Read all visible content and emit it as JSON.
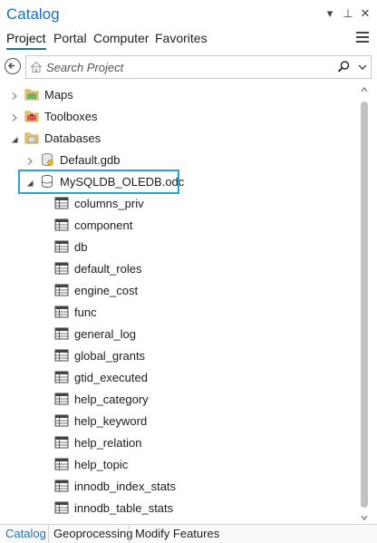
{
  "panel": {
    "title": "Catalog"
  },
  "title_buttons": {
    "options": "▾",
    "pin": "⊥",
    "close": "✕"
  },
  "tabs": [
    {
      "label": "Project",
      "active": true
    },
    {
      "label": "Portal",
      "active": false
    },
    {
      "label": "Computer",
      "active": false
    },
    {
      "label": "Favorites",
      "active": false
    }
  ],
  "search": {
    "placeholder": "Search Project",
    "value": ""
  },
  "tree": {
    "maps": "Maps",
    "toolboxes": "Toolboxes",
    "databases": "Databases",
    "default_gdb": "Default.gdb",
    "odc": "MySQLDB_OLEDB.odc",
    "tables": [
      "columns_priv",
      "component",
      "db",
      "default_roles",
      "engine_cost",
      "func",
      "general_log",
      "global_grants",
      "gtid_executed",
      "help_category",
      "help_keyword",
      "help_relation",
      "help_topic",
      "innodb_index_stats",
      "innodb_table_stats"
    ]
  },
  "bottom_tabs": [
    {
      "label": "Catalog",
      "active": true
    },
    {
      "label": "Geoprocessing",
      "active": false
    },
    {
      "label": "Modify Features",
      "active": false
    }
  ],
  "colors": {
    "accent": "#1f6fb3",
    "selection_border": "#29a4d6"
  }
}
